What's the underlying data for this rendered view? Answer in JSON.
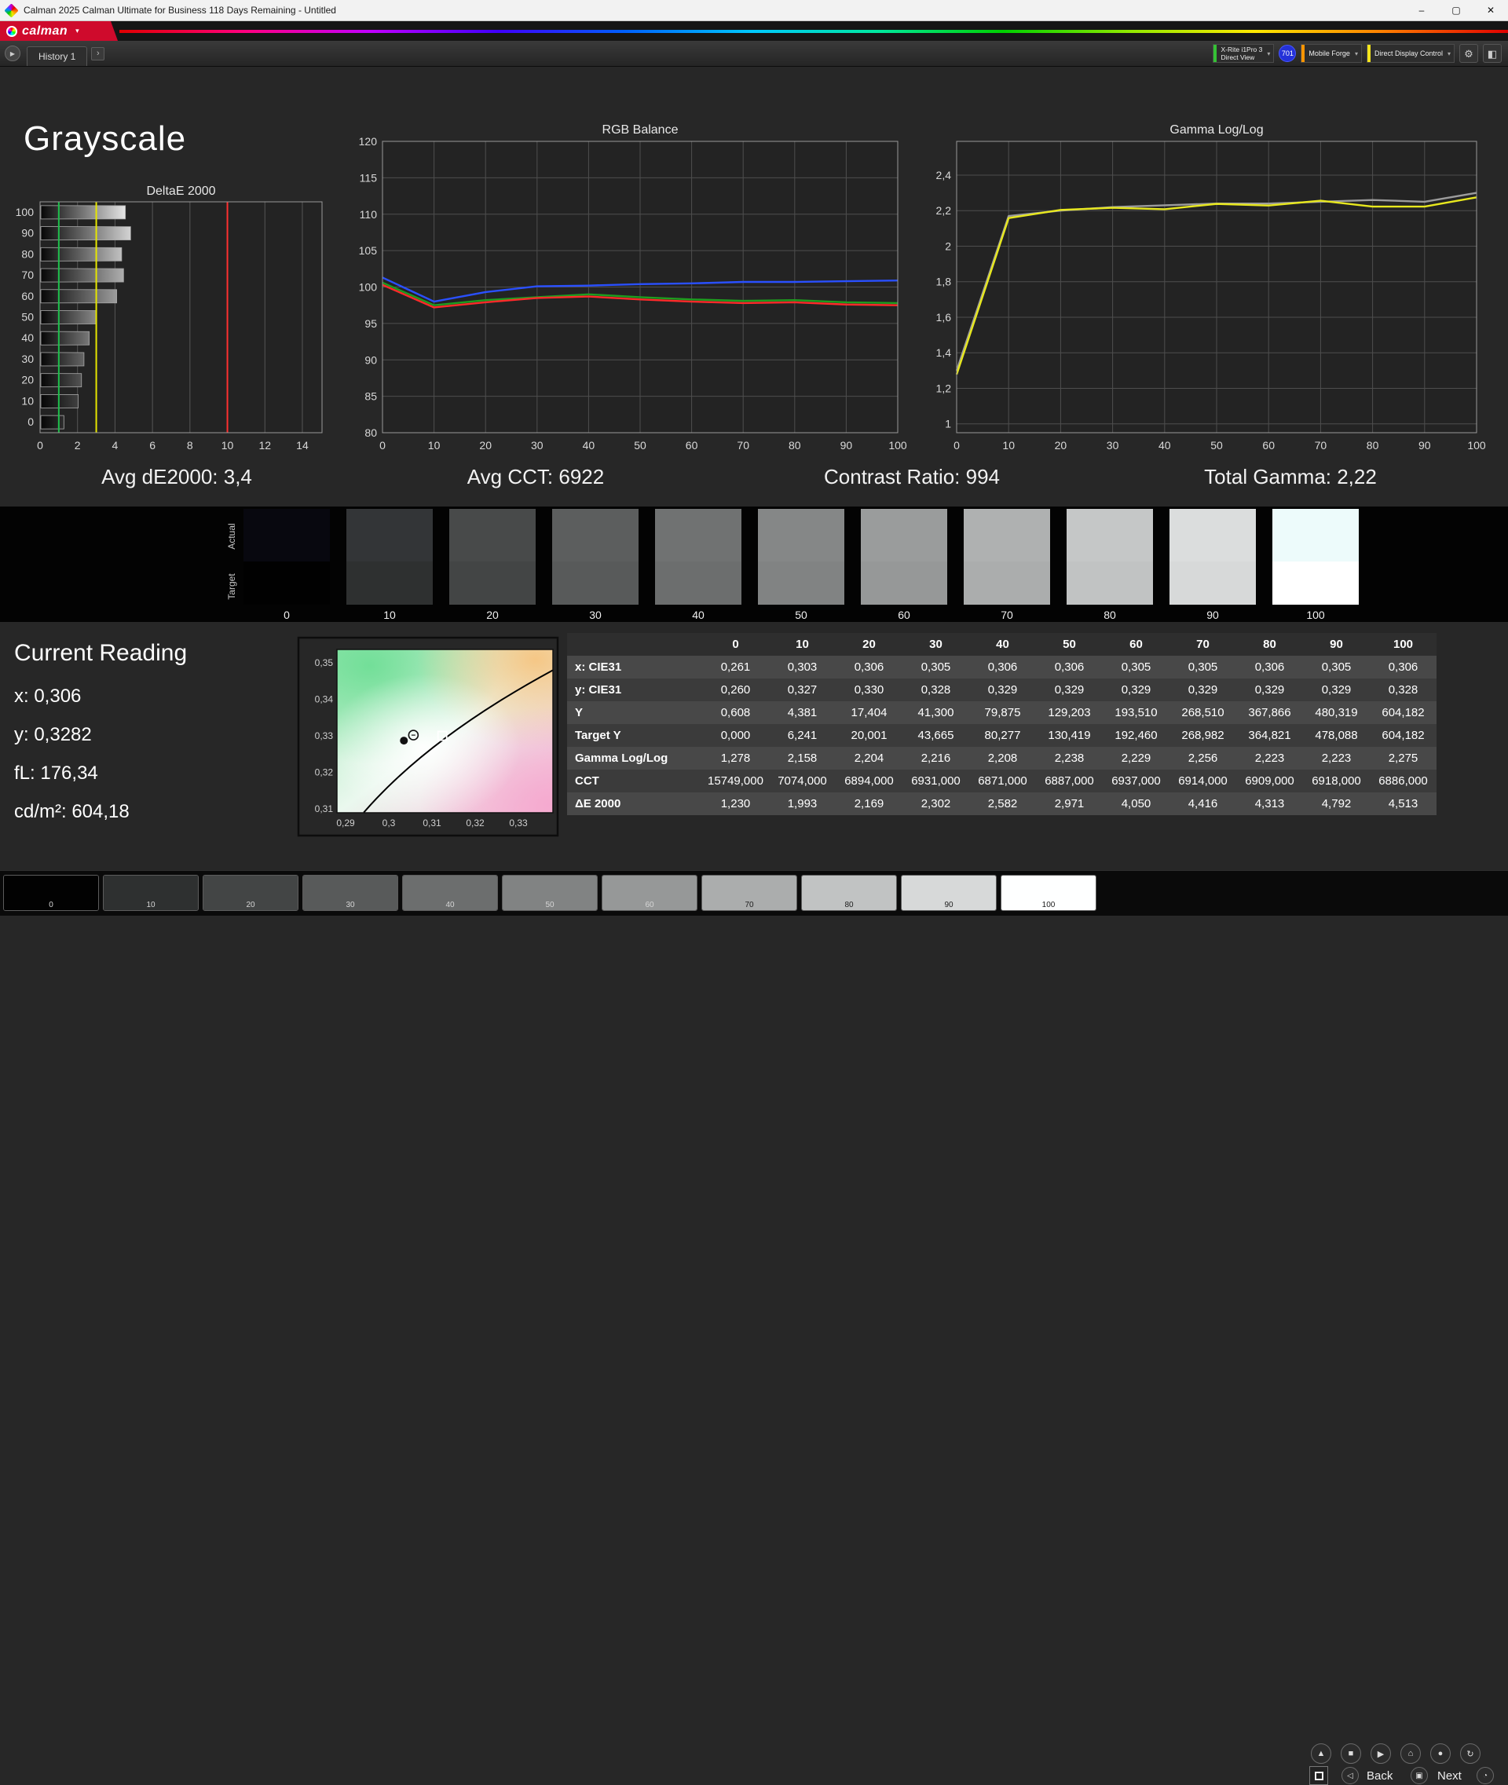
{
  "window": {
    "title": "Calman 2025 Calman Ultimate for Business 118 Days Remaining  - Untitled"
  },
  "icons": {
    "minimize": "–",
    "maximize": "▢",
    "close": "✕",
    "logo_caret": "▾",
    "dd_caret": "▾",
    "history_arrow": "▶",
    "history_next": "›",
    "gear": "⚙",
    "session": "◧",
    "nav_row1": [
      "▲",
      "■",
      "▶",
      "⌂",
      "●",
      "↻"
    ],
    "speaker": "◁",
    "meter": "▣",
    "gauge": "◔"
  },
  "brand": {
    "logo_text": "calman"
  },
  "toolbar": {
    "history_tab": "History 1",
    "meter_device": {
      "line1": "X-Rite i1Pro 3",
      "line2": "Direct View"
    },
    "badge": "701",
    "pattern_source": "Mobile Forge",
    "display_control": "Direct Display Control"
  },
  "page": {
    "title": "Grayscale"
  },
  "summary": {
    "avg_de2000": "Avg dE2000: 3,4",
    "avg_cct": "Avg CCT: 6922",
    "contrast_ratio": "Contrast Ratio: 994",
    "total_gamma": "Total Gamma: 2,22"
  },
  "chart_data": [
    {
      "id": "deltae",
      "type": "bar",
      "title": "DeltaE 2000",
      "orientation": "horizontal",
      "categories": [
        100,
        90,
        80,
        70,
        60,
        50,
        40,
        30,
        20,
        10,
        0
      ],
      "values": [
        4.513,
        4.792,
        4.313,
        4.416,
        4.05,
        2.971,
        2.582,
        2.302,
        2.169,
        1.993,
        1.23
      ],
      "xlim": [
        0,
        15.05
      ],
      "xticks": [
        0,
        2,
        4,
        6,
        8,
        10,
        12,
        14
      ],
      "reference_lines": [
        {
          "x": 1,
          "color": "#1fbf4c",
          "name": "green-tolerance"
        },
        {
          "x": 3,
          "color": "#e6e600",
          "name": "yellow-tolerance"
        },
        {
          "x": 10,
          "color": "#ff3030",
          "name": "red-tolerance"
        }
      ]
    },
    {
      "id": "rgb_balance",
      "type": "line",
      "title": "RGB Balance",
      "x": [
        0,
        10,
        20,
        30,
        40,
        50,
        60,
        70,
        80,
        90,
        100
      ],
      "ylim": [
        80,
        120
      ],
      "yticks": [
        80,
        85,
        90,
        95,
        100,
        105,
        110,
        115,
        120
      ],
      "series": [
        {
          "name": "Green",
          "color": "#1e9e1e",
          "values": [
            100.6,
            97.5,
            98.2,
            98.6,
            99.0,
            98.6,
            98.3,
            98.1,
            98.2,
            97.9,
            97.8
          ]
        },
        {
          "name": "Red",
          "color": "#ff2a2a",
          "values": [
            100.3,
            97.2,
            97.9,
            98.5,
            98.7,
            98.3,
            98.0,
            97.8,
            97.9,
            97.6,
            97.5
          ]
        },
        {
          "name": "Blue",
          "color": "#2a50ff",
          "values": [
            101.3,
            98.0,
            99.3,
            100.1,
            100.2,
            100.4,
            100.5,
            100.7,
            100.7,
            100.8,
            100.9
          ]
        }
      ]
    },
    {
      "id": "gamma",
      "type": "line",
      "title": "Gamma Log/Log",
      "x": [
        0,
        10,
        20,
        30,
        40,
        50,
        60,
        70,
        80,
        90,
        100
      ],
      "ylim": [
        0.95,
        2.59
      ],
      "yticks": [
        1,
        1.2,
        1.4,
        1.6,
        1.8,
        2,
        2.2,
        2.4
      ],
      "ytick_labels": [
        "1",
        "1,2",
        "1,4",
        "1,6",
        "1,8",
        "2",
        "2,2",
        "2,4"
      ],
      "series": [
        {
          "name": "Reference",
          "color": "#9c9c9c",
          "values": [
            1.3,
            2.17,
            2.2,
            2.22,
            2.23,
            2.24,
            2.24,
            2.25,
            2.26,
            2.25,
            2.3
          ]
        },
        {
          "name": "Measured",
          "color": "#e8e81e",
          "values": [
            1.278,
            2.158,
            2.204,
            2.216,
            2.208,
            2.238,
            2.229,
            2.256,
            2.223,
            2.223,
            2.275
          ]
        }
      ]
    },
    {
      "id": "cie",
      "type": "scatter",
      "title": "CIE xy",
      "xlim": [
        0.288,
        0.338
      ],
      "ylim": [
        0.30893,
        0.35366
      ],
      "xticks": [
        0.29,
        0.3,
        0.31,
        0.32,
        0.33
      ],
      "xtick_labels": [
        "0,29",
        "0,3",
        "0,31",
        "0,32",
        "0,33"
      ],
      "yticks": [
        0.31,
        0.32,
        0.33,
        0.34,
        0.35
      ],
      "ytick_labels": [
        "0,31",
        "0,32",
        "0,33",
        "0,34",
        "0,35"
      ],
      "locus": {
        "start": [
          0.2942,
          0.309
        ],
        "control": [
          0.3093,
          0.3296
        ],
        "end": [
          0.338,
          0.348
        ]
      },
      "points": [
        {
          "name": "measured",
          "marker": "dot",
          "x": 0.3035,
          "y": 0.3287
        },
        {
          "name": "reference",
          "marker": "circle",
          "x": 0.3057,
          "y": 0.3302
        },
        {
          "name": "target",
          "marker": "square",
          "x": 0.3124,
          "y": 0.33
        }
      ]
    }
  ],
  "swatches": {
    "row_labels": [
      "Actual",
      "Target"
    ],
    "levels": [
      {
        "label": "0",
        "actual": "#08080F",
        "target": "#010101"
      },
      {
        "label": "10",
        "actual": "#333537",
        "target": "#2E3030"
      },
      {
        "label": "20",
        "actual": "#484A4A",
        "target": "#434545"
      },
      {
        "label": "30",
        "actual": "#5C5E5E",
        "target": "#585A5A"
      },
      {
        "label": "40",
        "actual": "#707272",
        "target": "#6C6E6E"
      },
      {
        "label": "50",
        "actual": "#858787",
        "target": "#818383"
      },
      {
        "label": "60",
        "actual": "#9A9C9C",
        "target": "#969898"
      },
      {
        "label": "70",
        "actual": "#AFB1B1",
        "target": "#ABADAD"
      },
      {
        "label": "80",
        "actual": "#C5C7C7",
        "target": "#C1C3C3"
      },
      {
        "label": "90",
        "actual": "#DBDDDD",
        "target": "#D7D9D9"
      },
      {
        "label": "100",
        "actual": "#EDFBFB",
        "target": "#FFFFFF"
      }
    ]
  },
  "current_reading": {
    "title": "Current Reading",
    "lines": [
      "x: 0,306",
      "y: 0,3282",
      "fL: 176,34",
      "cd/m²: 604,18"
    ]
  },
  "table": {
    "columns": [
      "",
      "0",
      "10",
      "20",
      "30",
      "40",
      "50",
      "60",
      "70",
      "80",
      "90",
      "100"
    ],
    "rows": [
      {
        "label": "x: CIE31",
        "values": [
          "0,261",
          "0,303",
          "0,306",
          "0,305",
          "0,306",
          "0,306",
          "0,305",
          "0,305",
          "0,306",
          "0,305",
          "0,306"
        ]
      },
      {
        "label": "y: CIE31",
        "values": [
          "0,260",
          "0,327",
          "0,330",
          "0,328",
          "0,329",
          "0,329",
          "0,329",
          "0,329",
          "0,329",
          "0,329",
          "0,328"
        ]
      },
      {
        "label": "Y",
        "values": [
          "0,608",
          "4,381",
          "17,404",
          "41,300",
          "79,875",
          "129,203",
          "193,510",
          "268,510",
          "367,866",
          "480,319",
          "604,182"
        ]
      },
      {
        "label": "Target Y",
        "values": [
          "0,000",
          "6,241",
          "20,001",
          "43,665",
          "80,277",
          "130,419",
          "192,460",
          "268,982",
          "364,821",
          "478,088",
          "604,182"
        ]
      },
      {
        "label": "Gamma Log/Log",
        "values": [
          "1,278",
          "2,158",
          "2,204",
          "2,216",
          "2,208",
          "2,238",
          "2,229",
          "2,256",
          "2,223",
          "2,223",
          "2,275"
        ]
      },
      {
        "label": "CCT",
        "values": [
          "15749,000",
          "7074,000",
          "6894,000",
          "6931,000",
          "6871,000",
          "6887,000",
          "6937,000",
          "6914,000",
          "6909,000",
          "6918,000",
          "6886,000"
        ]
      },
      {
        "label": "ΔE 2000",
        "values": [
          "1,230",
          "1,993",
          "2,169",
          "2,302",
          "2,582",
          "2,971",
          "4,050",
          "4,416",
          "4,313",
          "4,792",
          "4,513"
        ]
      }
    ]
  },
  "bottom_bar": {
    "back_label": "Back",
    "next_label": "Next",
    "patches": [
      {
        "label": "0",
        "color": "#020202"
      },
      {
        "label": "10",
        "color": "#2E3030"
      },
      {
        "label": "20",
        "color": "#434545"
      },
      {
        "label": "30",
        "color": "#585A5A"
      },
      {
        "label": "40",
        "color": "#6C6E6E"
      },
      {
        "label": "50",
        "color": "#818383"
      },
      {
        "label": "60",
        "color": "#969898"
      },
      {
        "label": "70",
        "color": "#ABADAD"
      },
      {
        "label": "80",
        "color": "#C1C3C3"
      },
      {
        "label": "90",
        "color": "#D7D9D9"
      },
      {
        "label": "100",
        "color": "#FEFFFF"
      }
    ]
  }
}
